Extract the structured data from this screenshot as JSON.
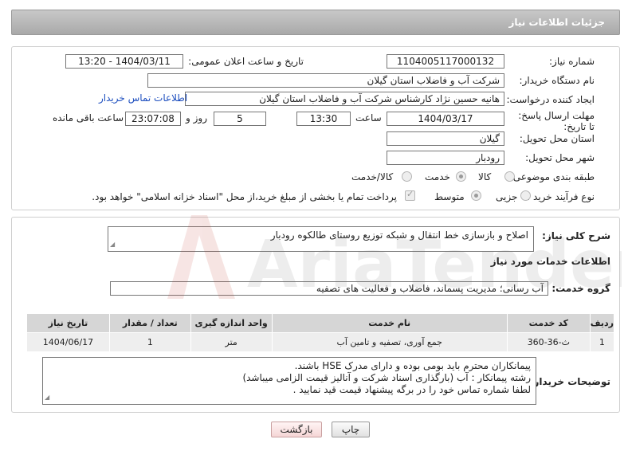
{
  "header": {
    "title": "جزئیات اطلاعات نیاز"
  },
  "form": {
    "need_number_label": "شماره نیاز:",
    "need_number": "1104005117000132",
    "announce_label": "تاریخ و ساعت اعلان عمومی:",
    "announce_value": "1404/03/11 - 13:20",
    "buyer_label": "نام دستگاه خریدار:",
    "buyer_value": "شرکت آب و فاضلاب استان گیلان",
    "creator_label": "ایجاد کننده درخواست:",
    "creator_value": "هانیه حسین نژاد کارشناس شرکت آب و فاضلاب استان گیلان",
    "contact_link": "اطلاعات تماس خریدار",
    "deadline_label": "مهلت ارسال پاسخ: تا تاریخ:",
    "deadline_date": "1404/03/17",
    "time_label": "ساعت",
    "deadline_time": "13:30",
    "days_value": "5",
    "days_label": "روز و",
    "remaining_time": "23:07:08",
    "remaining_label": "ساعت باقی مانده",
    "province_label": "استان محل تحویل:",
    "province_value": "گیلان",
    "city_label": "شهر محل تحویل:",
    "city_value": "رودبار",
    "category_label": "طبقه بندی موضوعی:",
    "category_options": [
      "کالا",
      "خدمت",
      "کالا/خدمت"
    ],
    "category_selected": "خدمت",
    "process_label": "نوع فرآیند خرید :",
    "process_options": [
      "جزیی",
      "متوسط"
    ],
    "process_selected": "متوسط",
    "payment_note": "پرداخت تمام یا بخشی از مبلغ خرید،از محل \"اسناد خزانه اسلامی\" خواهد بود."
  },
  "description": {
    "label": "شرح کلی نیاز:",
    "text": "اصلاح و بازسازی خط انتقال و شبکه توزیع روستای طالکوه رودبار"
  },
  "services": {
    "section_title": "اطلاعات خدمات مورد نیاز",
    "group_label": "گروه خدمت:",
    "group_value": "آب رسانی؛ مدیریت پسماند، فاضلاب و فعالیت های تصفیه",
    "columns": [
      "ردیف",
      "کد خدمت",
      "نام خدمت",
      "واحد اندازه گیری",
      "تعداد / مقدار",
      "تاریخ نیاز"
    ],
    "rows": [
      [
        "1",
        "ث-36-360",
        "جمع آوری، تصفیه و تامین آب",
        "متر",
        "1",
        "1404/06/17"
      ]
    ]
  },
  "buyer_notes": {
    "label": "توضیحات خریدار:",
    "lines": [
      "پیمانکاران محترم باید بومی بوده و  دارای مدرک HSE باشند.",
      "رشته پیمانکار :  آب  (بارگذاری اسناد شرکت و آنالیز قیمت الزامی میباشد)",
      "لطفا شماره تماس خود را در برگه پیشنهاد قیمت قید نمایید ."
    ]
  },
  "buttons": {
    "print": "چاپ",
    "back": "بازگشت"
  },
  "watermark": {
    "text": "AriaTender.net"
  }
}
